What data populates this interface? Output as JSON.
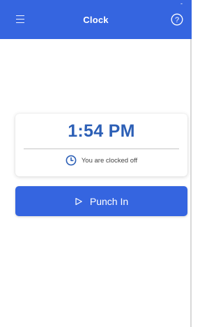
{
  "status_bar": {
    "indicator": "-"
  },
  "header": {
    "menu_icon": "hamburger-menu-icon",
    "title": "Clock",
    "help_icon": "help-circle-icon",
    "help_glyph": "?"
  },
  "clock_card": {
    "time": "1:54 PM",
    "status_icon": "clock-icon",
    "status_text": "You are clocked off"
  },
  "punch_button": {
    "icon": "play-outline-icon",
    "label": "Punch In"
  },
  "colors": {
    "primary": "#3565e0",
    "time_text": "#2c5fb6",
    "background": "#ffffff"
  }
}
